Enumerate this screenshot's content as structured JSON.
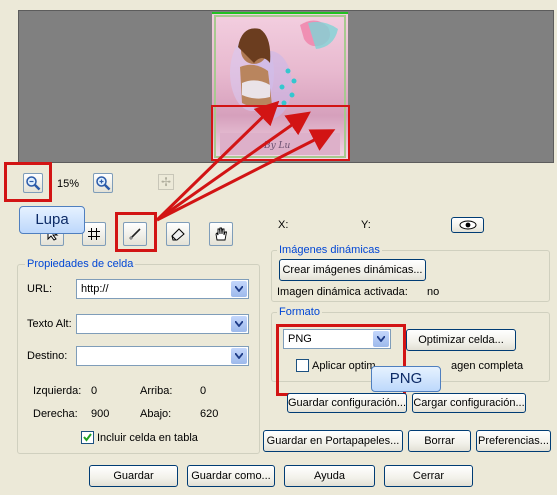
{
  "preview": {
    "zoom_value": "15%",
    "watermark": "By Lu"
  },
  "coords": {
    "x_label": "X:",
    "y_label": "Y:"
  },
  "callouts": {
    "lupa": "Lupa",
    "png": "PNG"
  },
  "cell_properties": {
    "legend": "Propiedades de celda",
    "url_label": "URL:",
    "url_value": "http://",
    "alt_label": "Texto Alt:",
    "alt_value": "",
    "dest_label": "Destino:",
    "dest_value": "",
    "left_label": "Izquierda:",
    "left_value": "0",
    "top_label": "Arriba:",
    "top_value": "0",
    "right_label": "Derecha:",
    "right_value": "900",
    "bottom_label": "Abajo:",
    "bottom_value": "620",
    "include_label": "Incluir celda en tabla",
    "include_checked": true
  },
  "dynamic_images": {
    "legend": "Imágenes dinámicas",
    "create_button": "Crear imágenes dinámicas...",
    "activated_label": "Imagen dinámica activada:",
    "activated_value": "no"
  },
  "format": {
    "legend": "Formato",
    "selected": "PNG",
    "optimize_button": "Optimizar celda...",
    "apply_label_left": "Aplicar optim",
    "apply_label_right": "agen completa",
    "apply_checked": false
  },
  "config_buttons": {
    "save_config": "Guardar configuración...",
    "load_config": "Cargar configuración..."
  },
  "actions": {
    "clipboard": "Guardar en Portapapeles...",
    "delete": "Borrar",
    "preferences": "Preferencias..."
  },
  "bottom_buttons": {
    "save": "Guardar",
    "save_as": "Guardar como...",
    "help": "Ayuda",
    "close": "Cerrar"
  },
  "colors": {
    "dialog_bg": "#ece9d8",
    "preview_bg": "#808080",
    "group_legend": "#0046d5",
    "highlight_red": "#d21414",
    "slice_green": "#22c022"
  }
}
